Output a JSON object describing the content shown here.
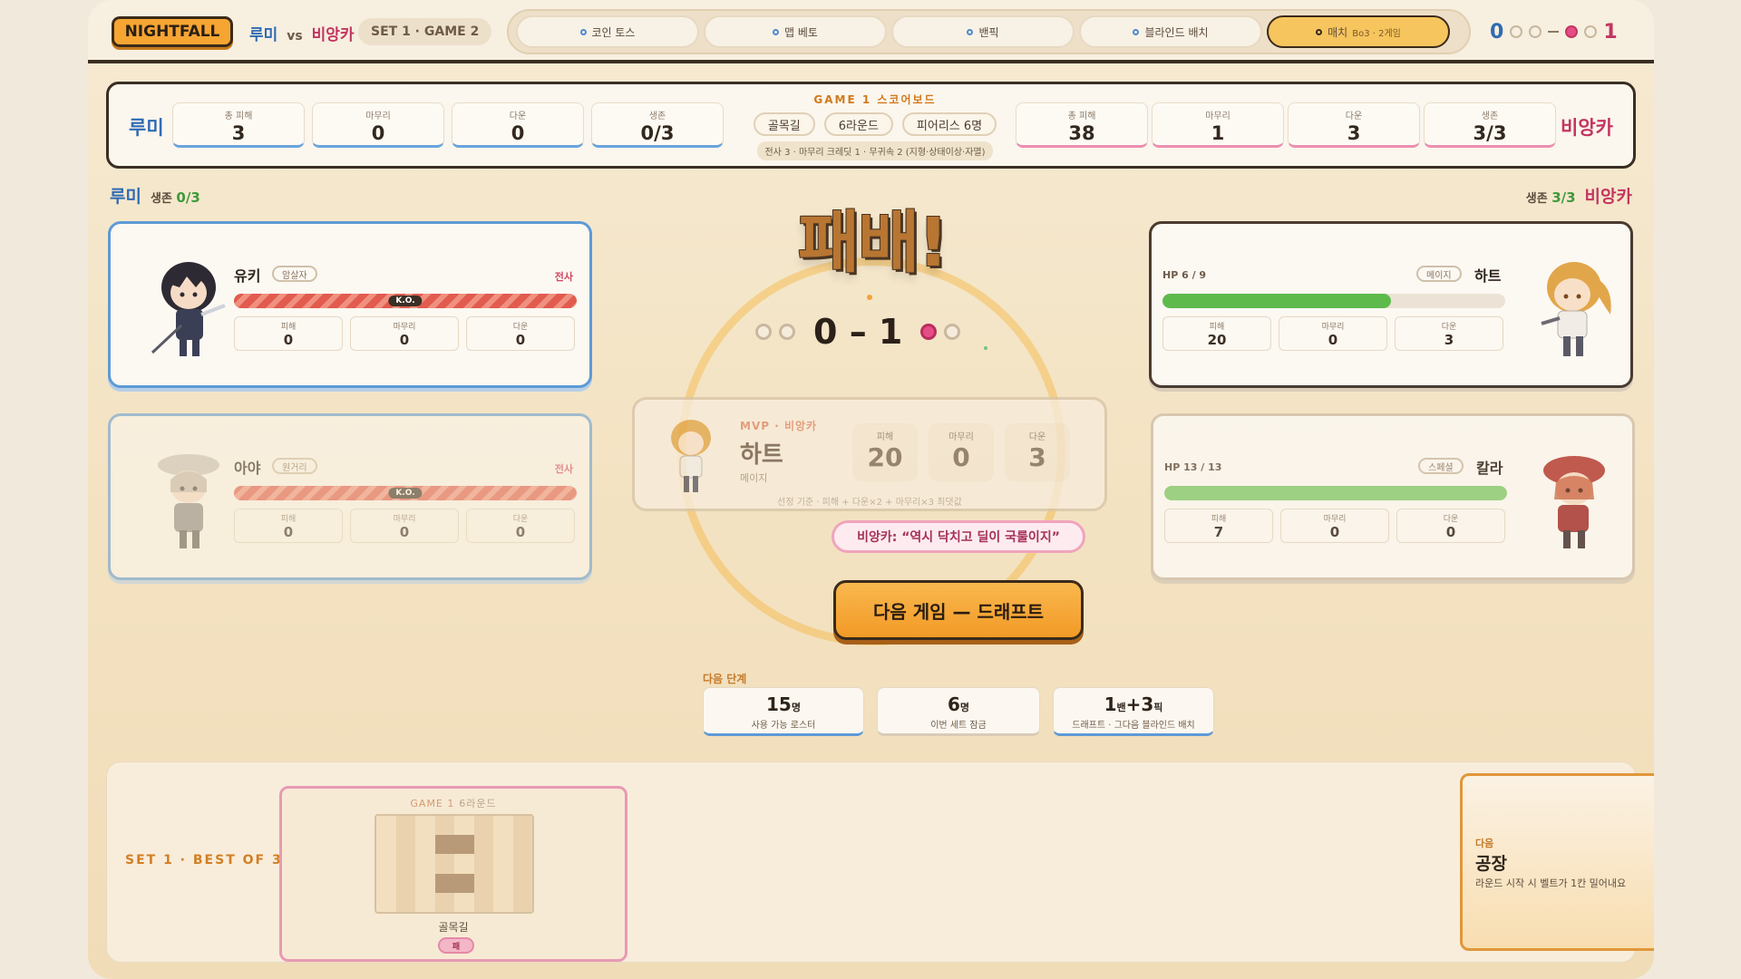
{
  "header": {
    "logo": "NIGHTFALL",
    "player_left": "루미",
    "vs": "vs",
    "player_right": "비앙카",
    "set_label": "SET 1 · GAME 2",
    "phases": [
      {
        "label": "코인 토스",
        "sub": ""
      },
      {
        "label": "맵 베토",
        "sub": ""
      },
      {
        "label": "밴픽",
        "sub": ""
      },
      {
        "label": "블라인드 배치",
        "sub": ""
      },
      {
        "label": "매치",
        "sub": "Bo3 · 2게임"
      }
    ],
    "active_phase": 4,
    "series_left": "0",
    "series_right": "1"
  },
  "scoreboard": {
    "title": "GAME 1 스코어보드",
    "left": {
      "name": "루미",
      "stats": [
        {
          "label": "총 피해",
          "value": "3"
        },
        {
          "label": "마무리",
          "value": "0"
        },
        {
          "label": "다운",
          "value": "0"
        },
        {
          "label": "생존",
          "value": "0/3"
        }
      ]
    },
    "right": {
      "name": "비앙카",
      "stats": [
        {
          "label": "총 피해",
          "value": "38"
        },
        {
          "label": "마무리",
          "value": "1"
        },
        {
          "label": "다운",
          "value": "3"
        },
        {
          "label": "생존",
          "value": "3/3"
        }
      ]
    },
    "pills": [
      "골목길",
      "6라운드",
      "피어리스 6명"
    ],
    "note": "전사 3 · 마무리 크레딧 1 · 무귀속 2 (지형·상태이상·자멸)"
  },
  "teams": {
    "left": {
      "name": "루미",
      "alive_label": "생존",
      "alive_value": "0/3"
    },
    "right": {
      "name": "비앙카",
      "alive_label": "생존",
      "alive_value": "3/3"
    }
  },
  "units_left": [
    {
      "name": "유키",
      "role": "암살자",
      "status": "전사",
      "ko": "K.O.",
      "stats": [
        {
          "label": "피해",
          "value": "0"
        },
        {
          "label": "마무리",
          "value": "0"
        },
        {
          "label": "다운",
          "value": "0"
        }
      ]
    },
    {
      "name": "아야",
      "role": "원거리",
      "status": "전사",
      "ko": "K.O.",
      "stats": [
        {
          "label": "피해",
          "value": "0"
        },
        {
          "label": "마무리",
          "value": "0"
        },
        {
          "label": "다운",
          "value": "0"
        }
      ]
    }
  ],
  "units_right": [
    {
      "name": "하트",
      "role": "메이지",
      "hp": "HP 6 / 9",
      "hp_fraction": 0.667,
      "stats": [
        {
          "label": "피해",
          "value": "20"
        },
        {
          "label": "마무리",
          "value": "0"
        },
        {
          "label": "다운",
          "value": "3"
        }
      ]
    },
    {
      "name": "칼라",
      "role": "스페셜",
      "hp": "HP 13 / 13",
      "hp_fraction": 1.0,
      "stats": [
        {
          "label": "피해",
          "value": "7"
        },
        {
          "label": "마무리",
          "value": "0"
        },
        {
          "label": "다운",
          "value": "0"
        }
      ]
    }
  ],
  "result": {
    "title": "패배!",
    "score_left": "0",
    "dash": "–",
    "score_right": "1"
  },
  "mvp": {
    "tag": "MVP · 비앙카",
    "name": "하트",
    "role": "메이지",
    "stats": [
      {
        "label": "피해",
        "value": "20"
      },
      {
        "label": "마무리",
        "value": "0"
      },
      {
        "label": "다운",
        "value": "3"
      }
    ],
    "basis": "선정 기준 · 피해 + 다운×2 + 마무리×3 최댓값"
  },
  "quote": "비앙카: “역시 닥치고 딜이 국룰이지”",
  "next_button": "다음 게임 — 드래프트",
  "next_stage": {
    "label": "다음 단계",
    "cards": [
      {
        "value": "15",
        "unit": "명",
        "desc": "사용 가능 로스터"
      },
      {
        "value": "6",
        "unit": "명",
        "desc": "이번 세트 잠금"
      },
      {
        "value": "1",
        "unit": "밴",
        "value2": "+3",
        "unit2": "픽",
        "desc": "드래프트 · 그다음 블라인드 배치"
      }
    ]
  },
  "bottom": {
    "set_title": "SET 1 · BEST OF 3",
    "game": {
      "label": "GAME 1",
      "rounds": "6라운드",
      "map": "골목길",
      "result": "패"
    },
    "upcoming": {
      "label": "다음",
      "name": "공장",
      "desc": "라운드 시작 시 벨트가 1칸 밀어내요"
    }
  },
  "colors": {
    "blue": "#2f6bb3",
    "pink": "#c33560",
    "accent": "#f6a533"
  }
}
